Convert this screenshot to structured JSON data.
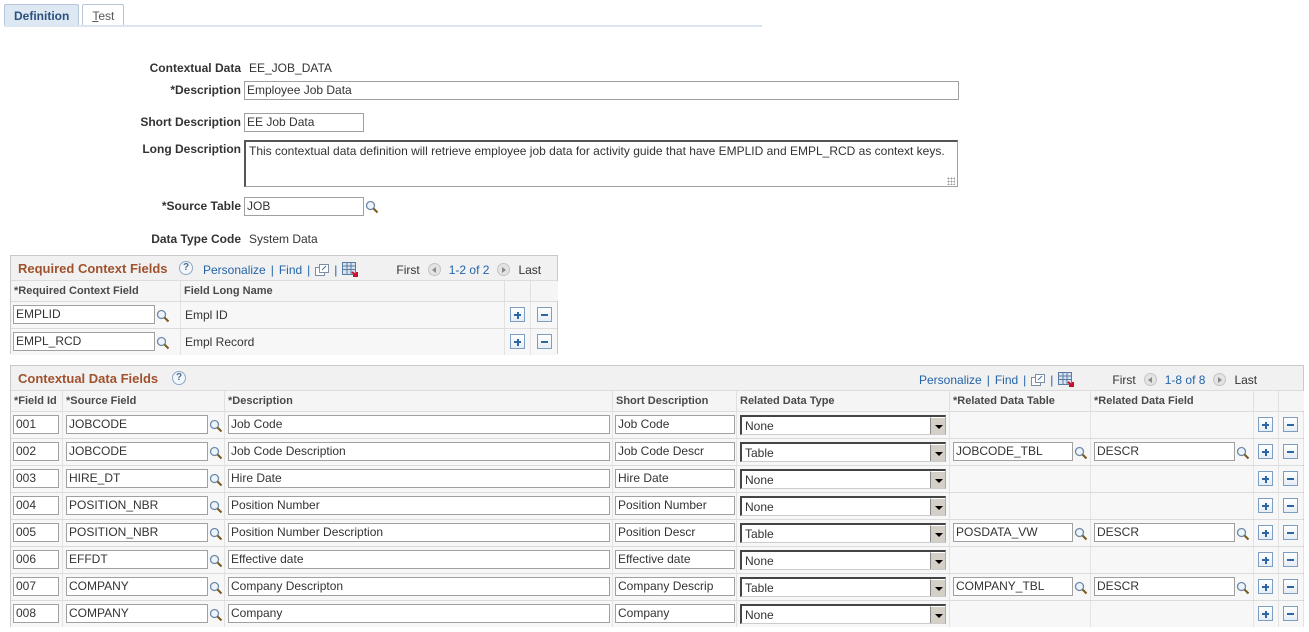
{
  "tabs": [
    {
      "label": "Definition",
      "active": true
    },
    {
      "label": "Test",
      "accesskey": "T",
      "rest": "est",
      "active": false
    }
  ],
  "form": {
    "contextual_data_label": "Contextual Data",
    "contextual_data_value": "EE_JOB_DATA",
    "description_label": "*Description",
    "description_value": "Employee Job Data",
    "short_description_label": "Short Description",
    "short_description_value": "EE Job Data",
    "long_description_label": "Long Description",
    "long_description_value": "This contextual data definition will retrieve employee job data for activity guide that have EMPLID and EMPL_RCD as context keys.",
    "source_table_label": "*Source Table",
    "source_table_value": "JOB",
    "data_type_code_label": "Data Type Code",
    "data_type_code_value": "System Data"
  },
  "required_context_grid": {
    "title": "Required Context Fields",
    "help": "?",
    "personalize": "Personalize",
    "find": "Find",
    "sep": "|",
    "first": "First",
    "range": "1-2 of 2",
    "last": "Last",
    "columns": [
      "*Required Context Field",
      "Field Long Name"
    ],
    "rows": [
      {
        "field": "EMPLID",
        "long_name": "Empl ID"
      },
      {
        "field": "EMPL_RCD",
        "long_name": "Empl Record"
      }
    ]
  },
  "contextual_data_grid": {
    "title": "Contextual Data Fields",
    "help": "?",
    "personalize": "Personalize",
    "find": "Find",
    "sep": "|",
    "first": "First",
    "range": "1-8 of 8",
    "last": "Last",
    "columns": [
      "*Field Id",
      "*Source Field",
      "*Description",
      "Short Description",
      "Related Data Type",
      "*Related Data Table",
      "*Related Data Field"
    ],
    "rows": [
      {
        "id": "001",
        "source": "JOBCODE",
        "description": "Job Code",
        "short": "Job Code",
        "type": "None",
        "table": "",
        "field": ""
      },
      {
        "id": "002",
        "source": "JOBCODE",
        "description": "Job Code Description",
        "short": "Job Code Descr",
        "type": "Table",
        "table": "JOBCODE_TBL",
        "field": "DESCR"
      },
      {
        "id": "003",
        "source": "HIRE_DT",
        "description": "Hire Date",
        "short": "Hire Date",
        "type": "None",
        "table": "",
        "field": ""
      },
      {
        "id": "004",
        "source": "POSITION_NBR",
        "description": "Position Number",
        "short": "Position Number",
        "type": "None",
        "table": "",
        "field": ""
      },
      {
        "id": "005",
        "source": "POSITION_NBR",
        "description": "Position Number Description",
        "short": "Position Descr",
        "type": "Table",
        "table": "POSDATA_VW",
        "field": "DESCR"
      },
      {
        "id": "006",
        "source": "EFFDT",
        "description": "Effective date",
        "short": "Effective date",
        "type": "None",
        "table": "",
        "field": ""
      },
      {
        "id": "007",
        "source": "COMPANY",
        "description": "Company Descripton",
        "short": "Company Descrip",
        "type": "Table",
        "table": "COMPANY_TBL",
        "field": "DESCR"
      },
      {
        "id": "008",
        "source": "COMPANY",
        "description": "Company",
        "short": "Company",
        "type": "None",
        "table": "",
        "field": ""
      }
    ]
  },
  "colors": {
    "grid_title": "#a0522d",
    "link": "#2364a9",
    "tab_active_bg": "#dde8f3"
  }
}
